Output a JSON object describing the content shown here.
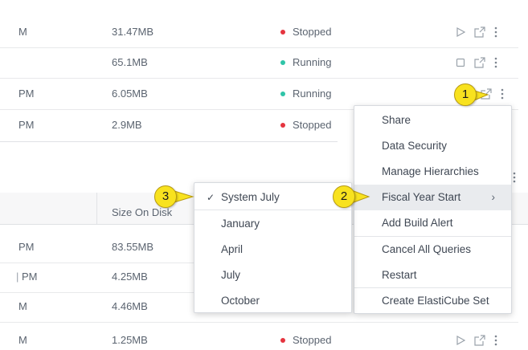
{
  "rows_top": [
    {
      "time": "M",
      "size": "31.47MB",
      "status": "Stopped",
      "state": "stopped",
      "action": "play-icon"
    },
    {
      "time": "",
      "size": "65.1MB",
      "status": "Running",
      "state": "running",
      "action": "stop-icon"
    },
    {
      "time": "PM",
      "size": "6.05MB",
      "status": "Running",
      "state": "running",
      "action": ""
    },
    {
      "time": "PM",
      "size": "2.9MB",
      "status": "Stopped",
      "state": "stopped",
      "action": ""
    }
  ],
  "table2": {
    "header": {
      "size_col": "Size On Disk"
    },
    "rows": [
      {
        "time": "PM",
        "size": "83.55MB"
      },
      {
        "time": "PM",
        "size": "4.25MB"
      },
      {
        "time": "M",
        "size": "4.46MB"
      },
      {
        "time": "M",
        "size": "1.25MB",
        "status": "Stopped"
      }
    ]
  },
  "context_menu": {
    "items": [
      {
        "label": "Share"
      },
      {
        "label": "Data Security"
      },
      {
        "label": "Manage Hierarchies"
      },
      {
        "label": "Fiscal Year Start"
      },
      {
        "label": "Add Build Alert"
      },
      {
        "label": "Cancel All Queries"
      },
      {
        "label": "Restart"
      },
      {
        "label": "Create ElastiCube Set"
      }
    ],
    "submenu_chevron": "›"
  },
  "fiscal_submenu": {
    "items": [
      {
        "label": "System July",
        "checked": true
      },
      {
        "label": "January",
        "checked": false
      },
      {
        "label": "April",
        "checked": false
      },
      {
        "label": "July",
        "checked": false
      },
      {
        "label": "October",
        "checked": false
      }
    ],
    "check_glyph": "✓"
  },
  "callouts": [
    {
      "number": "1"
    },
    {
      "number": "2"
    },
    {
      "number": "3"
    }
  ],
  "colors": {
    "stopped": "#e5343f",
    "running": "#2fc4a8",
    "callout": "#f8e21f",
    "menu_highlight": "#e9ebee"
  }
}
